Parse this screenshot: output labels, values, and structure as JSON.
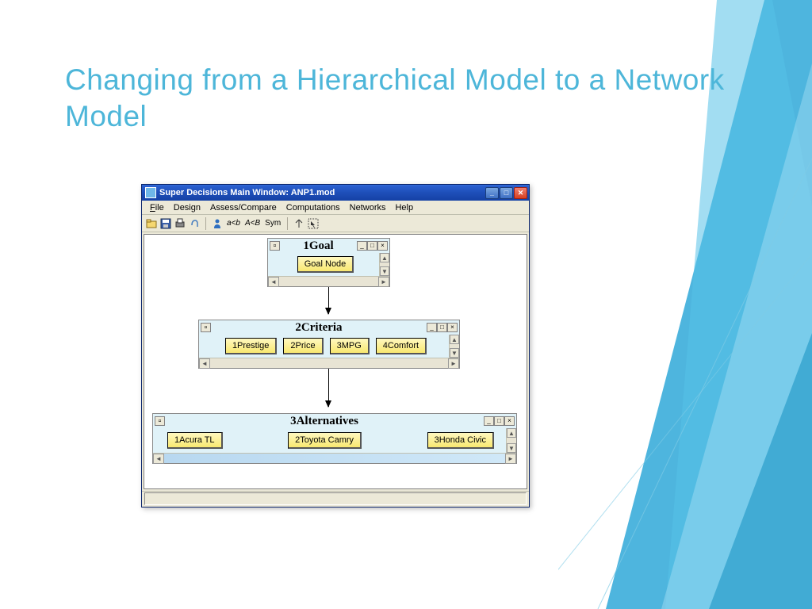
{
  "slide": {
    "title": "Changing from a Hierarchical Model to a Network Model"
  },
  "window": {
    "title": "Super Decisions Main Window: ANP1.mod",
    "menu": {
      "file": "File",
      "design": "Design",
      "assess": "Assess/Compare",
      "computations": "Computations",
      "networks": "Networks",
      "help": "Help"
    },
    "toolbar": {
      "formula1": "a<b",
      "formula2": "A<B",
      "sym": "Sym"
    }
  },
  "clusters": {
    "goal": {
      "title": "1Goal",
      "nodes": {
        "n0": "Goal Node"
      }
    },
    "criteria": {
      "title": "2Criteria",
      "nodes": {
        "n0": "1Prestige",
        "n1": "2Price",
        "n2": "3MPG",
        "n3": "4Comfort"
      }
    },
    "alternatives": {
      "title": "3Alternatives",
      "nodes": {
        "n0": "1Acura TL",
        "n1": "2Toyota Camry",
        "n2": "3Honda Civic"
      }
    }
  }
}
